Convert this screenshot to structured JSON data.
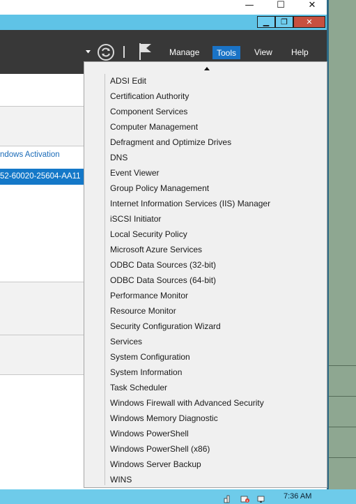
{
  "outer_window": {
    "minimize_glyph": "—",
    "maximize_glyph": "☐",
    "close_glyph": "✕"
  },
  "inner_window": {
    "minimize_glyph": "▁",
    "restore_glyph": "❐",
    "close_glyph": "✕"
  },
  "header": {
    "menu_manage": "Manage",
    "menu_tools": "Tools",
    "menu_view": "View",
    "menu_help": "Help",
    "tools_active_color": "#1a73c6"
  },
  "body": {
    "activation_link": "ndows Activation",
    "product_id": "52-60020-25604-AA11"
  },
  "tools_menu": {
    "items": [
      "ADSI Edit",
      "Certification Authority",
      "Component Services",
      "Computer Management",
      "Defragment and Optimize Drives",
      "DNS",
      "Event Viewer",
      "Group Policy Management",
      "Internet Information Services (IIS) Manager",
      "iSCSI Initiator",
      "Local Security Policy",
      "Microsoft Azure Services",
      "ODBC Data Sources (32-bit)",
      "ODBC Data Sources (64-bit)",
      "Performance Monitor",
      "Resource Monitor",
      "Security Configuration Wizard",
      "Services",
      "System Configuration",
      "System Information",
      "Task Scheduler",
      "Windows Firewall with Advanced Security",
      "Windows Memory Diagnostic",
      "Windows PowerShell",
      "Windows PowerShell (x86)",
      "Windows Server Backup",
      "WINS"
    ]
  },
  "taskbar": {
    "clock": "7:36 AM"
  }
}
